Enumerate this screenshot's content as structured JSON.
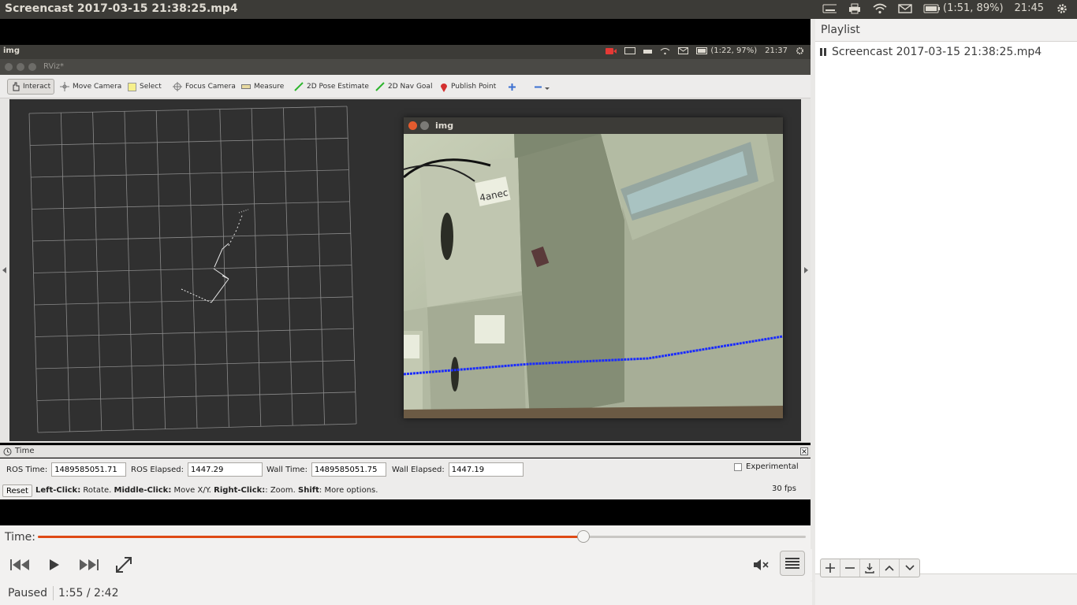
{
  "system_bar": {
    "window_title": "Screencast 2017-03-15 21:38:25.mp4",
    "battery": "(1:51, 89%)",
    "clock": "21:45"
  },
  "recorded": {
    "top_bar_title": "img",
    "battery": "(1:22, 97%)",
    "clock": "21:37",
    "rviz_title": "RViz*",
    "tools": [
      {
        "label": "Interact",
        "icon": "hand-icon"
      },
      {
        "label": "Move Camera",
        "icon": "move-icon"
      },
      {
        "label": "Select",
        "icon": "select-icon"
      },
      {
        "label": "Focus Camera",
        "icon": "focus-icon"
      },
      {
        "label": "Measure",
        "icon": "ruler-icon"
      },
      {
        "label": "2D Pose Estimate",
        "icon": "pose-arrow-icon"
      },
      {
        "label": "2D Nav Goal",
        "icon": "goal-arrow-icon"
      },
      {
        "label": "Publish Point",
        "icon": "map-pin-icon"
      }
    ],
    "img_window_title": "img",
    "camera_overlay_text": "4anec",
    "time_panel": {
      "title": "Time",
      "ros_time_label": "ROS Time:",
      "ros_time": "1489585051.71",
      "ros_elapsed_label": "ROS Elapsed:",
      "ros_elapsed": "1447.29",
      "wall_time_label": "Wall Time:",
      "wall_time": "1489585051.75",
      "wall_elapsed_label": "Wall Elapsed:",
      "wall_elapsed": "1447.19",
      "experimental_label": "Experimental"
    },
    "status": {
      "reset_label": "Reset",
      "left_click": "Left-Click:",
      "left_click_text": " Rotate. ",
      "middle_click": "Middle-Click:",
      "middle_click_text": " Move X/Y. ",
      "right_click": "Right-Click:",
      "right_click_text": ": Zoom. ",
      "shift": "Shift",
      "shift_text": ": More options.",
      "fps": "30 fps"
    }
  },
  "player": {
    "time_label": "Time:",
    "progress_fraction": 0.71,
    "state": "Paused",
    "position": "1:55 / 2:42"
  },
  "playlist": {
    "header": "Playlist",
    "items": [
      {
        "label": "Screencast 2017-03-15 21:38:25.mp4"
      }
    ]
  },
  "colors": {
    "accent": "#df4a16",
    "laser_line": "#1a2bff"
  }
}
